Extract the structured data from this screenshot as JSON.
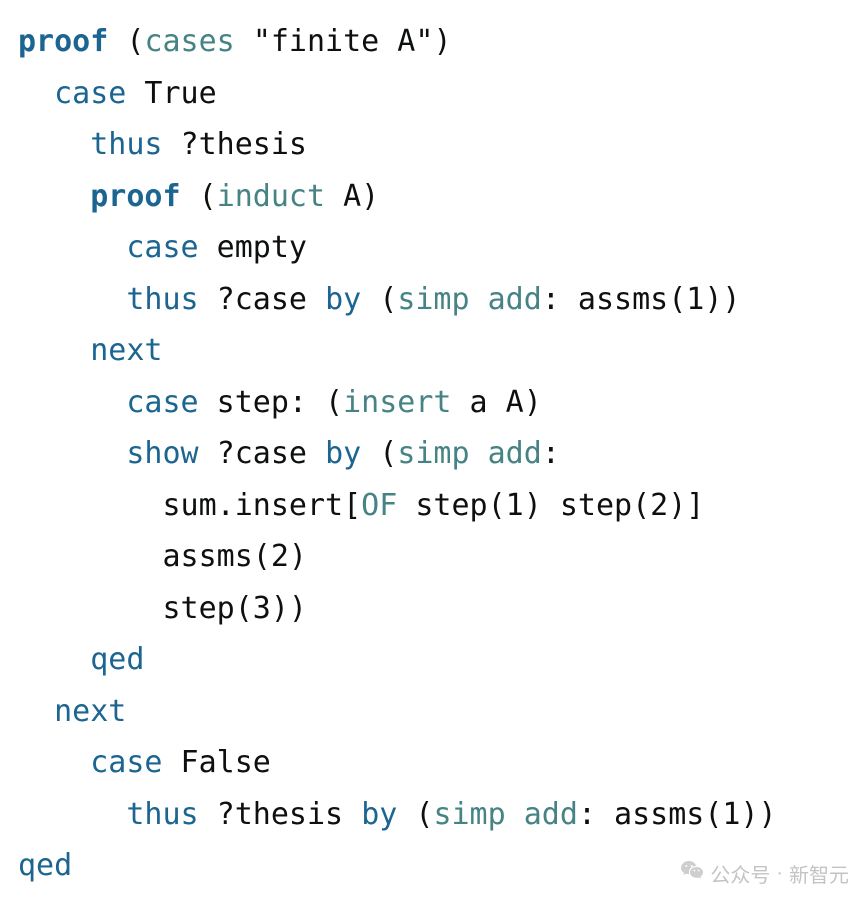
{
  "tokens": [
    [
      [
        "proof",
        "bold-steel"
      ],
      [
        " (",
        "plain"
      ],
      [
        "cases",
        "teal"
      ],
      [
        " ",
        "plain"
      ],
      [
        "\"finite A\"",
        "plain"
      ],
      [
        ")",
        "plain"
      ]
    ],
    [
      [
        "  ",
        "plain"
      ],
      [
        "case",
        "steel"
      ],
      [
        " True",
        "plain"
      ]
    ],
    [
      [
        "    ",
        "plain"
      ],
      [
        "thus",
        "steel"
      ],
      [
        " ?thesis",
        "plain"
      ]
    ],
    [
      [
        "    ",
        "plain"
      ],
      [
        "proof",
        "bold-steel"
      ],
      [
        " (",
        "plain"
      ],
      [
        "induct",
        "teal"
      ],
      [
        " A)",
        "plain"
      ]
    ],
    [
      [
        "      ",
        "plain"
      ],
      [
        "case",
        "steel"
      ],
      [
        " empty",
        "plain"
      ]
    ],
    [
      [
        "      ",
        "plain"
      ],
      [
        "thus",
        "steel"
      ],
      [
        " ?case ",
        "plain"
      ],
      [
        "by",
        "steel"
      ],
      [
        " (",
        "plain"
      ],
      [
        "simp",
        "teal"
      ],
      [
        " ",
        "plain"
      ],
      [
        "add",
        "teal"
      ],
      [
        ": assms(1))",
        "plain"
      ]
    ],
    [
      [
        "    ",
        "plain"
      ],
      [
        "next",
        "steel"
      ]
    ],
    [
      [
        "      ",
        "plain"
      ],
      [
        "case",
        "steel"
      ],
      [
        " step: (",
        "plain"
      ],
      [
        "insert",
        "teal"
      ],
      [
        " a A)",
        "plain"
      ]
    ],
    [
      [
        "      ",
        "plain"
      ],
      [
        "show",
        "steel"
      ],
      [
        " ?case ",
        "plain"
      ],
      [
        "by",
        "steel"
      ],
      [
        " (",
        "plain"
      ],
      [
        "simp",
        "teal"
      ],
      [
        " ",
        "plain"
      ],
      [
        "add",
        "teal"
      ],
      [
        ":",
        "plain"
      ]
    ],
    [
      [
        "        sum.insert[",
        "plain"
      ],
      [
        "OF",
        "teal"
      ],
      [
        " step(1) step(2)]",
        "plain"
      ]
    ],
    [
      [
        "        assms(2)",
        "plain"
      ]
    ],
    [
      [
        "        step(3))",
        "plain"
      ]
    ],
    [
      [
        "    ",
        "plain"
      ],
      [
        "qed",
        "steel"
      ]
    ],
    [
      [
        "  ",
        "plain"
      ],
      [
        "next",
        "steel"
      ]
    ],
    [
      [
        "    ",
        "plain"
      ],
      [
        "case",
        "steel"
      ],
      [
        " False",
        "plain"
      ]
    ],
    [
      [
        "      ",
        "plain"
      ],
      [
        "thus",
        "steel"
      ],
      [
        " ?thesis ",
        "plain"
      ],
      [
        "by",
        "steel"
      ],
      [
        " (",
        "plain"
      ],
      [
        "simp",
        "teal"
      ],
      [
        " ",
        "plain"
      ],
      [
        "add",
        "teal"
      ],
      [
        ": assms(1))",
        "plain"
      ]
    ],
    [
      [
        "qed",
        "steel"
      ]
    ]
  ],
  "watermark": {
    "prefix": "公众号",
    "separator": "·",
    "name": "新智元"
  }
}
